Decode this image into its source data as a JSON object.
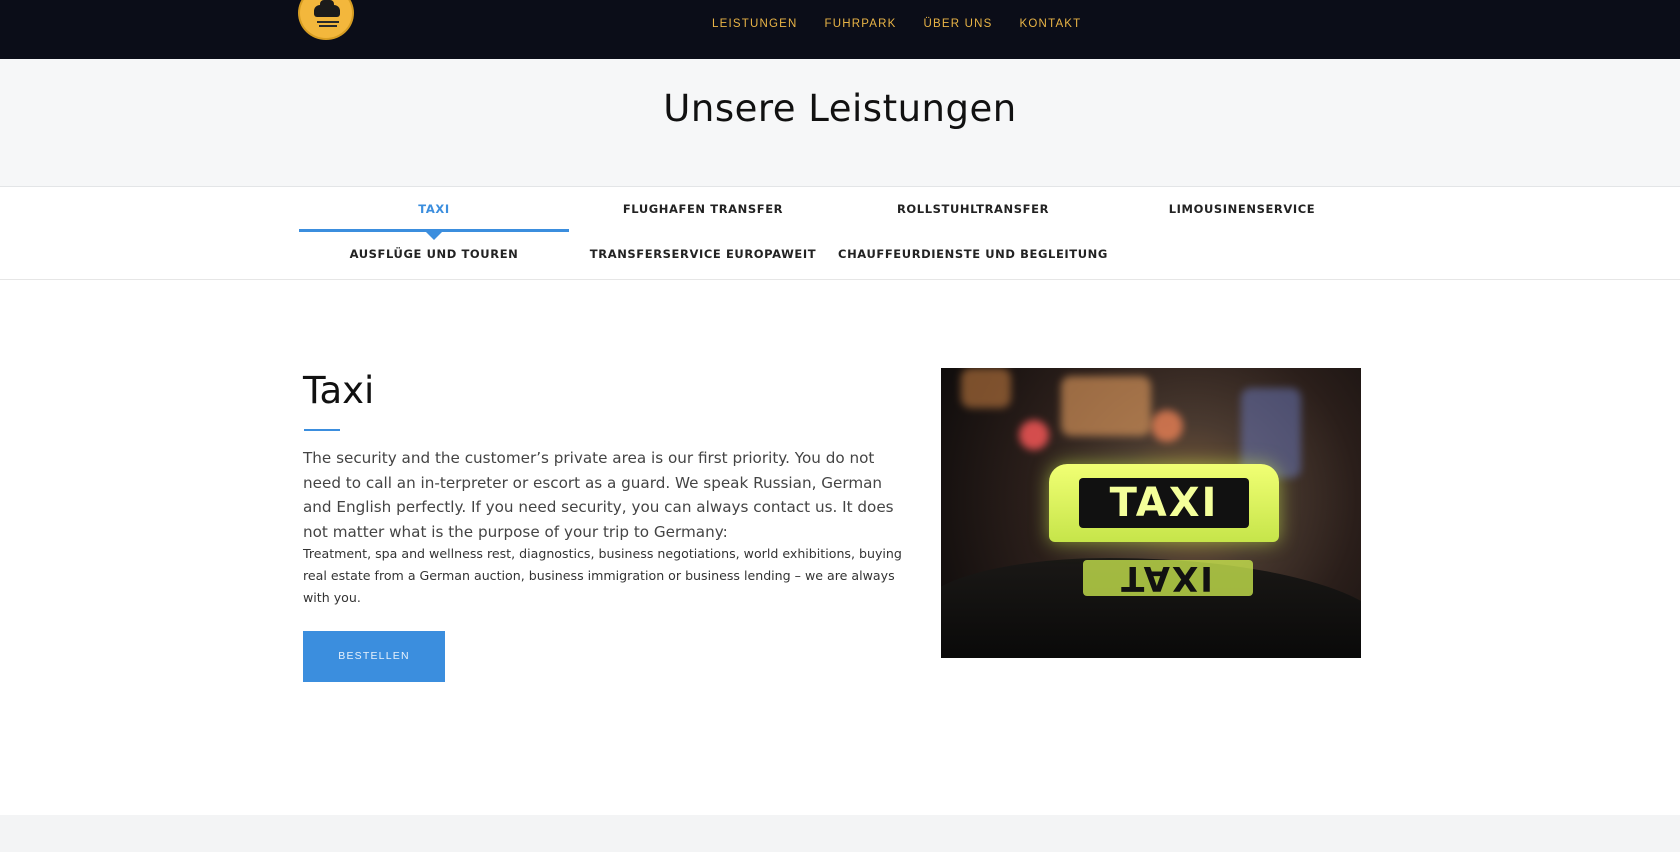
{
  "brand": {
    "logo_icon": "taxi-logo-icon"
  },
  "nav": {
    "items": [
      "LEISTUNGEN",
      "FUHRPARK",
      "ÜBER UNS",
      "KONTAKT"
    ]
  },
  "hero": {
    "title": "Unsere Leistungen"
  },
  "tabs": {
    "items": [
      {
        "label": "TAXI",
        "active": true
      },
      {
        "label": "FLUGHAFEN TRANSFER",
        "active": false
      },
      {
        "label": "ROLLSTUHLTRANSFER",
        "active": false
      },
      {
        "label": "LIMOUSINENSERVICE",
        "active": false
      },
      {
        "label": "AUSFLÜGE UND TOUREN",
        "active": false
      },
      {
        "label": "TRANSFERSERVICE EUROPAWEIT",
        "active": false
      },
      {
        "label": "CHAUFFEURDIENSTE UND BEGLEITUNG",
        "active": false
      }
    ]
  },
  "content": {
    "title": "Taxi",
    "paragraph": "The security and the customer’s private area is our first priority. You do not need to call an in-terpreter or escort as a guard. We speak Russian, German and English perfectly. If you need security, you can always contact us. It does not matter what is the purpose of your trip to Germany:",
    "paragraph_small": "Treatment, spa and wellness rest, diagnostics, business negotiations, world exhibitions, buying real estate from a German auction, business immigration or business lending – we are always with you.",
    "button_label": "BESTELLEN",
    "image_sign_text": "TAXI"
  },
  "colors": {
    "navbar_bg": "#0b0d18",
    "nav_link": "#e9b446",
    "accent": "#3b8ede"
  }
}
